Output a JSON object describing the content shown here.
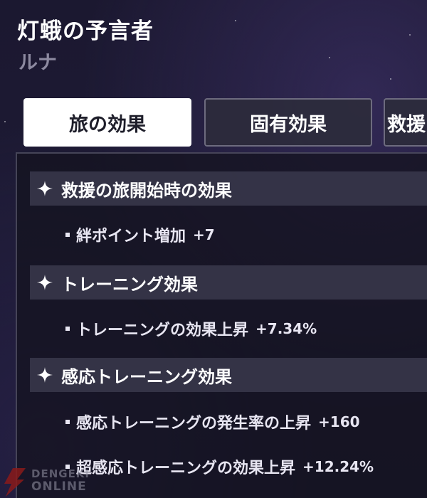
{
  "header": {
    "title": "灯蛾の予言者",
    "subtitle": "ルナ"
  },
  "tabs": [
    {
      "label": "旅の効果",
      "active": true
    },
    {
      "label": "固有効果",
      "active": false
    },
    {
      "label": "救援",
      "active": false
    }
  ],
  "sections": [
    {
      "icon": "sparkle-icon",
      "title": "救援の旅開始時の効果",
      "effects": [
        {
          "label": "絆ポイント増加",
          "value": "+7"
        }
      ]
    },
    {
      "icon": "sparkle-icon",
      "title": "トレーニング効果",
      "effects": [
        {
          "label": "トレーニングの効果上昇",
          "value": "+7.34%"
        }
      ]
    },
    {
      "icon": "sparkle-icon",
      "title": "感応トレーニング効果",
      "effects": [
        {
          "label": "感応トレーニングの発生率の上昇",
          "value": "+160"
        },
        {
          "label": "超感応トレーニングの効果上昇",
          "value": "+12.24%"
        }
      ]
    }
  ],
  "watermark": {
    "line1": "DENGEKI",
    "line2": "ONLINE",
    "color": "#8a1a1a"
  },
  "colors": {
    "background": "#1c1932",
    "tab_active_bg": "#ffffff",
    "tab_active_text": "#1e1e2a",
    "tab_inactive_bg": "#2d2b3c",
    "subtitle": "#8d8aa0",
    "section_bar": "#3a384c"
  }
}
